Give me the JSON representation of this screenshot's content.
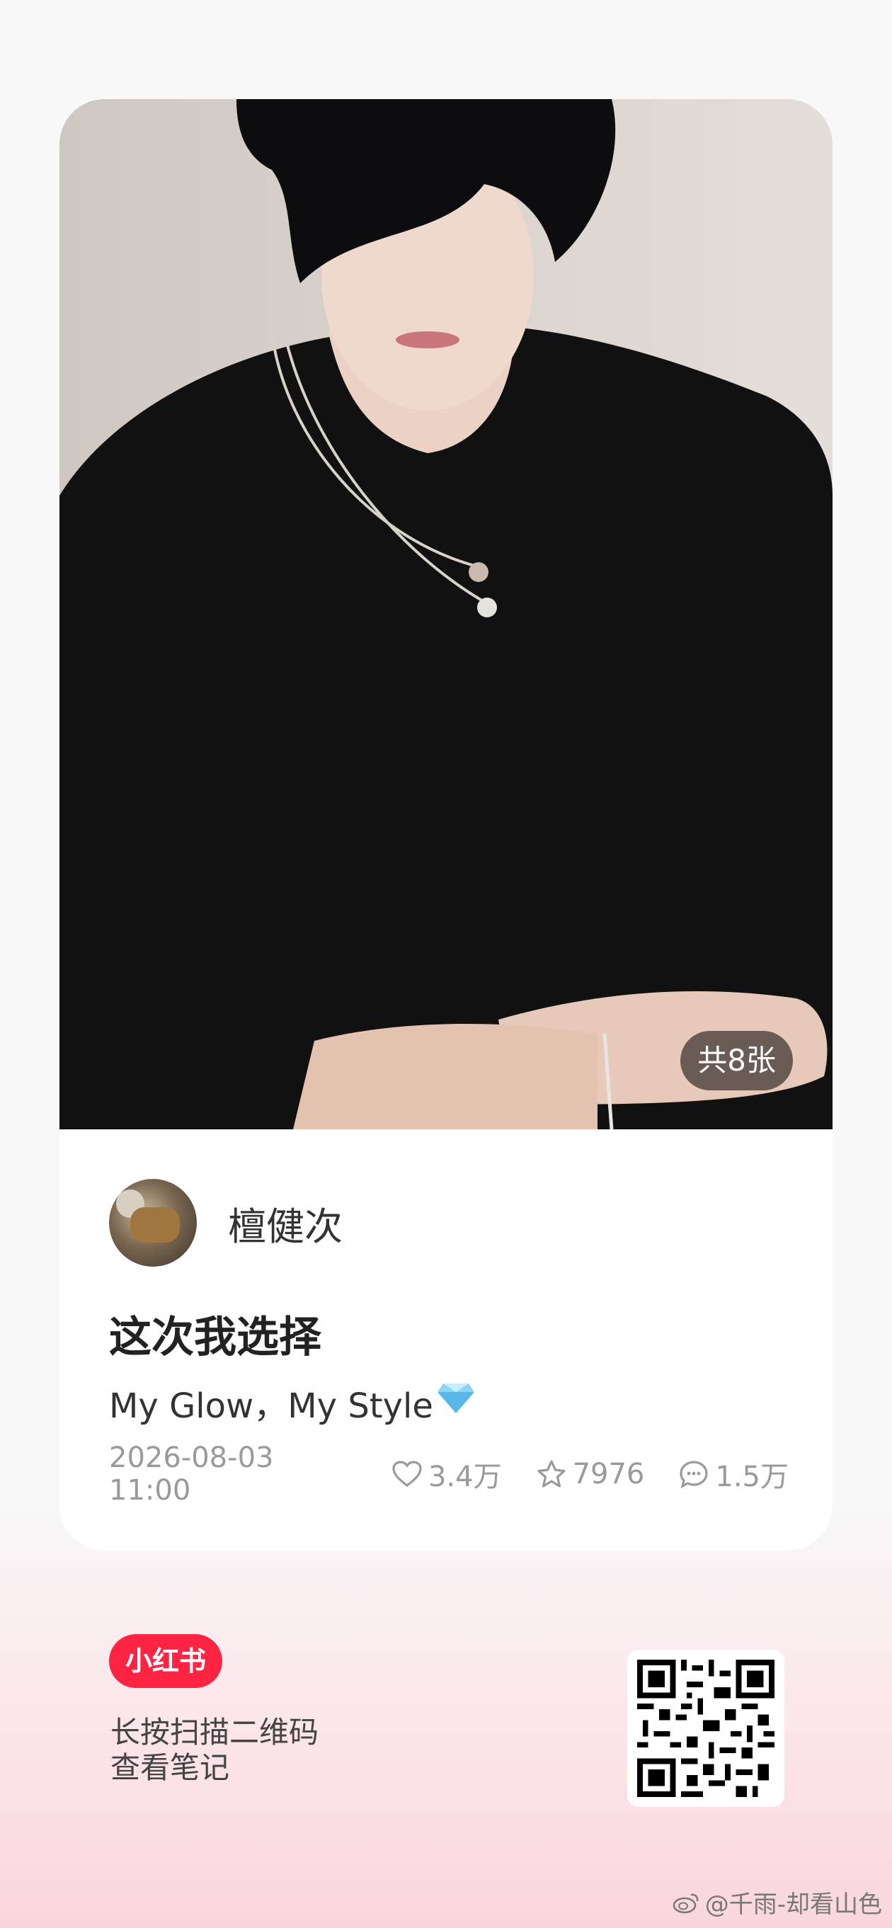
{
  "post": {
    "image_count_label": "共8张",
    "author_name": "檀健次",
    "title": "这次我选择",
    "description": "My Glow，My Style",
    "date": "2026-08-03 11:00",
    "likes": "3.4万",
    "collects": "7976",
    "comments": "1.5万"
  },
  "footer": {
    "logo_text": "小红书",
    "scan_line1": "长按扫描二维码",
    "scan_line2": "查看笔记",
    "watermark": "@千雨-却看山色"
  },
  "colors": {
    "brand": "#ff2442",
    "card_bg": "#ffffff",
    "meta_text": "#9a9a9a"
  },
  "icons": [
    "heart-icon",
    "star-icon",
    "comment-icon",
    "gem-icon",
    "weibo-icon",
    "qr-code"
  ]
}
